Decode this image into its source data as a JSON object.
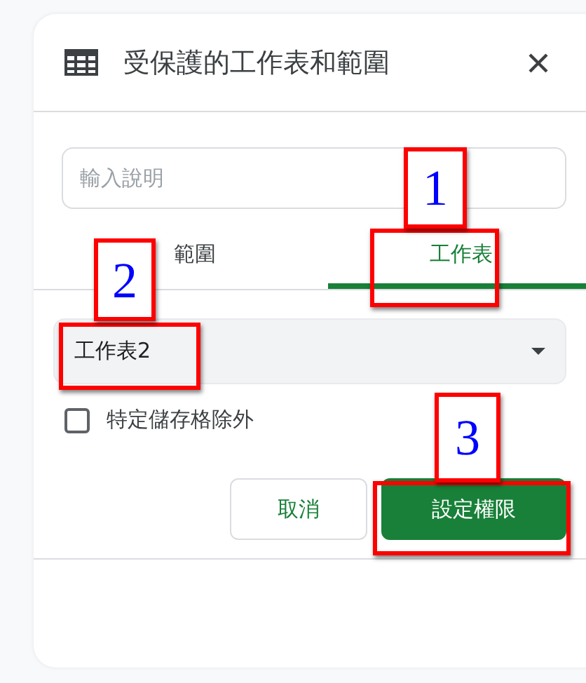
{
  "panel": {
    "title": "受保護的工作表和範圍",
    "description": {
      "placeholder": "輸入說明"
    }
  },
  "tabs": [
    {
      "label": "範圍",
      "selected": false
    },
    {
      "label": "工作表",
      "selected": true
    }
  ],
  "sheet_select": {
    "value": "工作表2"
  },
  "except_cells": {
    "label": "特定儲存格除外",
    "checked": false
  },
  "buttons": [
    {
      "label": "取消",
      "kind": "secondary"
    },
    {
      "label": "設定權限",
      "kind": "primary"
    }
  ],
  "annotations": [
    {
      "label": "1"
    },
    {
      "label": "2"
    },
    {
      "label": "3"
    }
  ]
}
